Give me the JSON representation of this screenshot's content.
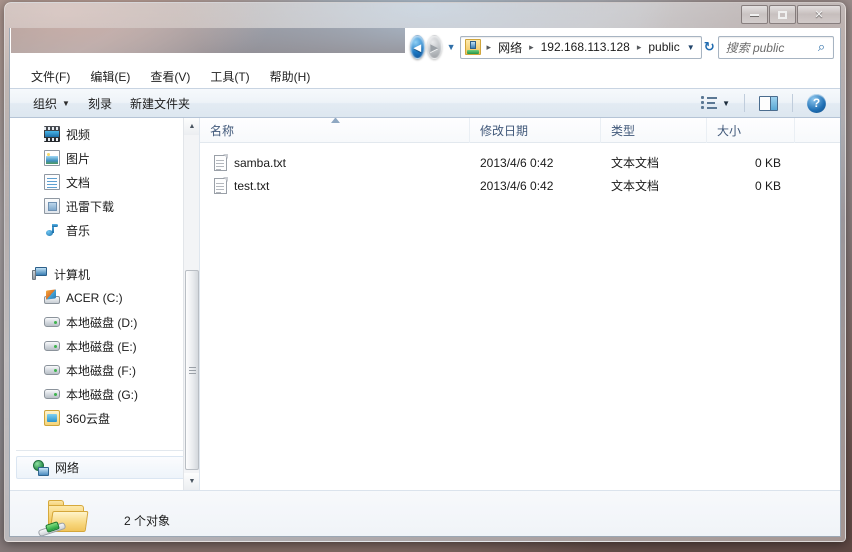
{
  "window": {
    "buttons": {
      "minimize": "minimize",
      "maximize": "maximize",
      "close": "✕"
    }
  },
  "address": {
    "breadcrumbs": [
      "网络",
      "192.168.113.128",
      "public"
    ],
    "separator": "▸",
    "back_glyph": "◄",
    "forward_glyph": "►",
    "history_glyph": "▼",
    "dropdown_glyph": "▼",
    "refresh_glyph": "↻"
  },
  "search": {
    "placeholder": "搜索 public",
    "icon_glyph": "⌕"
  },
  "menu": {
    "items": [
      {
        "label": "文件(F)"
      },
      {
        "label": "编辑(E)"
      },
      {
        "label": "查看(V)"
      },
      {
        "label": "工具(T)"
      },
      {
        "label": "帮助(H)"
      }
    ]
  },
  "toolbar": {
    "organize_label": "组织",
    "organize_caret": "▼",
    "burn_label": "刻录",
    "new_folder_label": "新建文件夹",
    "view_caret": "▼",
    "help_glyph": "?"
  },
  "navigation": {
    "items": [
      {
        "label": "视频",
        "level": 1,
        "icon": "video-icon"
      },
      {
        "label": "图片",
        "level": 1,
        "icon": "picture-icon"
      },
      {
        "label": "文档",
        "level": 1,
        "icon": "document-icon"
      },
      {
        "label": "迅雷下载",
        "level": 1,
        "icon": "download-icon"
      },
      {
        "label": "音乐",
        "level": 1,
        "icon": "music-icon"
      },
      {
        "label": "计算机",
        "level": 0,
        "icon": "computer-icon"
      },
      {
        "label": "ACER (C:)",
        "level": 1,
        "icon": "system-drive-icon"
      },
      {
        "label": "本地磁盘 (D:)",
        "level": 1,
        "icon": "hard-drive-icon"
      },
      {
        "label": "本地磁盘 (E:)",
        "level": 1,
        "icon": "hard-drive-icon"
      },
      {
        "label": "本地磁盘 (F:)",
        "level": 1,
        "icon": "hard-drive-icon"
      },
      {
        "label": "本地磁盘 (G:)",
        "level": 1,
        "icon": "hard-drive-icon"
      },
      {
        "label": "360云盘",
        "level": 1,
        "icon": "cloud-drive-icon"
      }
    ],
    "network_item": {
      "label": "网络",
      "icon": "network-icon"
    },
    "scroll_up_glyph": "▲",
    "scroll_down_glyph": "▼"
  },
  "filelist": {
    "columns": [
      {
        "key": "name",
        "label": "名称"
      },
      {
        "key": "date",
        "label": "修改日期"
      },
      {
        "key": "type",
        "label": "类型"
      },
      {
        "key": "size",
        "label": "大小"
      }
    ],
    "sort_column": "名称",
    "sort_direction": "ascending",
    "rows": [
      {
        "name": "samba.txt",
        "date": "2013/4/6 0:42",
        "type": "文本文档",
        "size": "0 KB",
        "icon": "text-file-icon"
      },
      {
        "name": "test.txt",
        "date": "2013/4/6 0:42",
        "type": "文本文档",
        "size": "0 KB",
        "icon": "text-file-icon"
      }
    ]
  },
  "statusbar": {
    "text": "2 个对象",
    "icon": "shared-folder-icon"
  },
  "colors": {
    "accent": "#1f6fb4",
    "column_header_text": "#41597a",
    "command_bar_top": "#f6f9fc",
    "command_bar_bottom": "#dde7f0"
  }
}
